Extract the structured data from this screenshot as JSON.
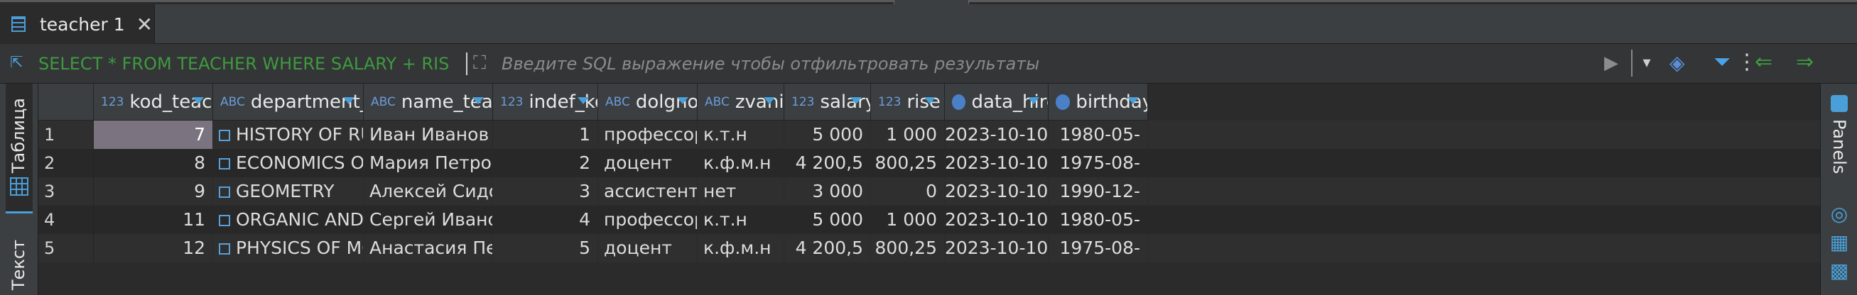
{
  "tab": {
    "title": "teacher 1",
    "close": "✕"
  },
  "filter": {
    "value": "SELECT * FROM TEACHER WHERE SALARY + RIS",
    "placeholder": "Введите SQL выражение чтобы отфильтровать результаты"
  },
  "left_panel": {
    "table_tab": "Таблица",
    "text_tab": "Текст"
  },
  "right_panel": {
    "panels_label": "Panels"
  },
  "columns": [
    {
      "type": "123",
      "label": "kod_teacher"
    },
    {
      "type": "ABC",
      "label": "department_name"
    },
    {
      "type": "ABC",
      "label": "name_teacher"
    },
    {
      "type": "123",
      "label": "indef_kod"
    },
    {
      "type": "ABC",
      "label": "dolgnost"
    },
    {
      "type": "ABC",
      "label": "zvanie"
    },
    {
      "type": "123",
      "label": "salary"
    },
    {
      "type": "123",
      "label": "rise"
    },
    {
      "type": "date",
      "label": "data_hire"
    },
    {
      "type": "date",
      "label": "birthday"
    }
  ],
  "rows": [
    {
      "n": "1",
      "kod_teacher": "7",
      "department_name": "HISTORY OF RUSSIA",
      "name_teacher": "Иван Иванов",
      "indef_kod": "1",
      "dolgnost": "профессор",
      "zvanie": "к.т.н",
      "salary": "5 000",
      "rise": "1 000",
      "data_hire": "2023-10-10",
      "birthday": "1980-05-"
    },
    {
      "n": "2",
      "kod_teacher": "8",
      "department_name": "ECONOMICS OF PRODUC",
      "name_teacher": "Мария Петрова",
      "indef_kod": "2",
      "dolgnost": "доцент",
      "zvanie": "к.ф.м.н",
      "salary": "4 200,5",
      "rise": "800,25",
      "data_hire": "2023-10-10",
      "birthday": "1975-08-"
    },
    {
      "n": "3",
      "kod_teacher": "9",
      "department_name": "GEOMETRY",
      "name_teacher": "Алексей Сидоров",
      "indef_kod": "3",
      "dolgnost": "ассистент",
      "zvanie": "нет",
      "salary": "3 000",
      "rise": "0",
      "data_hire": "2023-10-10",
      "birthday": "1990-12-"
    },
    {
      "n": "4",
      "kod_teacher": "11",
      "department_name": "ORGANIC AND MEDICINA",
      "name_teacher": "Сергей Иванов",
      "indef_kod": "4",
      "dolgnost": "профессор",
      "zvanie": "к.т.н",
      "salary": "5 000",
      "rise": "1 000",
      "data_hire": "2023-10-10",
      "birthday": "1980-05-"
    },
    {
      "n": "5",
      "kod_teacher": "12",
      "department_name": "PHYSICS OF MOLECULAR",
      "name_teacher": "Анастасия Петрова",
      "indef_kod": "5",
      "dolgnost": "доцент",
      "zvanie": "к.ф.м.н",
      "salary": "4 200,5",
      "rise": "800,25",
      "data_hire": "2023-10-10",
      "birthday": "1975-08-"
    }
  ],
  "selected": {
    "row": 0,
    "column": "kod_teacher"
  },
  "colors": {
    "accent": "#4a9fd8",
    "filter_text": "#3f9a3f",
    "selection": "#7b7480"
  }
}
